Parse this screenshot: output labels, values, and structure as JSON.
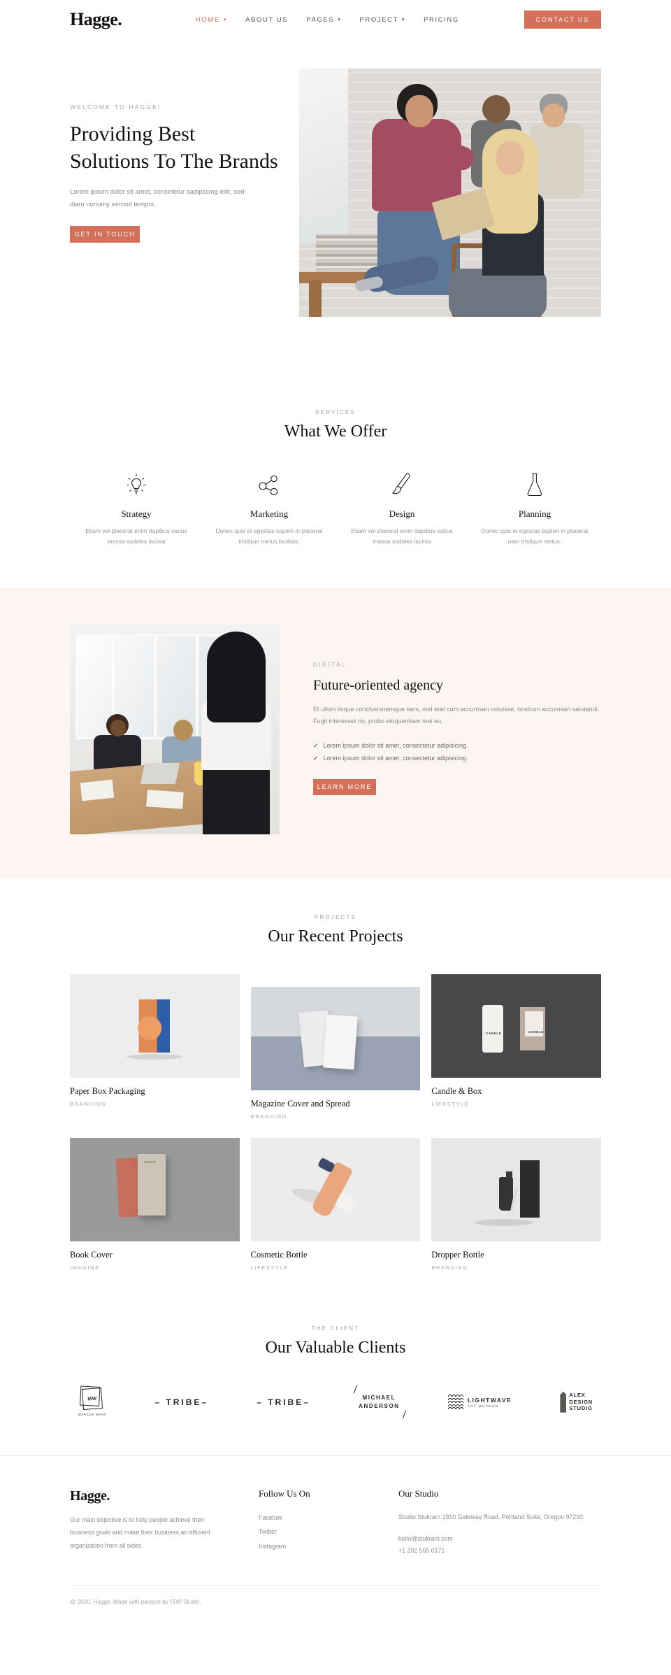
{
  "header": {
    "brand": "Hagge.",
    "nav": [
      {
        "label": "HOME",
        "has_caret": true,
        "active": true
      },
      {
        "label": "ABOUT US",
        "has_caret": false,
        "active": false
      },
      {
        "label": "PAGES",
        "has_caret": true,
        "active": false
      },
      {
        "label": "PROJECT",
        "has_caret": true,
        "active": false
      },
      {
        "label": "PRICING",
        "has_caret": false,
        "active": false
      }
    ],
    "cta_label": "CONTACT US"
  },
  "hero": {
    "eyebrow": "WELCOME TO HAGGE!",
    "title": "Providing Best Solutions To The Brands",
    "text": "Lorem ipsum dolor sit amet, consetetur sadipscing elitr, sed diam nonumy eirmod tempor.",
    "button": "GET IN TOUCH"
  },
  "services": {
    "eyebrow": "SERVICES",
    "title": "What We Offer",
    "items": [
      {
        "icon": "lightbulb-icon",
        "name": "Strategy",
        "desc": "Etiam vel placerat enim dapibus varius massa sodales lacinia"
      },
      {
        "icon": "network-icon",
        "name": "Marketing",
        "desc": "Donec quis et egestas sapien in placerat tristique metus facilisis."
      },
      {
        "icon": "brush-icon",
        "name": "Design",
        "desc": "Etiam vel placerat enim dapibus varius massa sodales lacinia"
      },
      {
        "icon": "flask-icon",
        "name": "Planning",
        "desc": "Donec quis et egestas sapien in placerat nam tristique metus."
      }
    ]
  },
  "about": {
    "eyebrow": "DIGITAL",
    "title": "Future-oriented agency",
    "paragraph": "Et ullum iisque conclusionemque eam, mel erat cum accumsan noluisse, nostrum accumsan salutandi. Fugit interesset no, probo eloquentiam mei eu.",
    "list": [
      "Lorem ipsum dolor sit amet, consectetur adipisicing.",
      "Lorem ipsum dolor sit amet, consectetur adipisicing."
    ],
    "button": "LEARN MORE"
  },
  "projects": {
    "eyebrow": "PROJECTS",
    "title": "Our Recent Projects",
    "items": [
      {
        "name": "Paper Box Packaging",
        "category": "BRANDING"
      },
      {
        "name": "Magazine Cover and Spread",
        "category": "BRANDING"
      },
      {
        "name": "Candle & Box",
        "category": "LIFESTYLE"
      },
      {
        "name": "Book Cover",
        "category": "IMAGINE"
      },
      {
        "name": "Cosmetic Bottle",
        "category": "LIFESTYLE"
      },
      {
        "name": "Dropper Bottle",
        "category": "BRANDING"
      }
    ]
  },
  "clients": {
    "eyebrow": "THE CLIENT",
    "title": "Our Valuable Clients",
    "logos": [
      {
        "type": "marcus-wayn",
        "mark": "MW",
        "sub": "MARCUS WAYN"
      },
      {
        "type": "tribe",
        "text": "– TRIBE–"
      },
      {
        "type": "tribe",
        "text": "– TRIBE–"
      },
      {
        "type": "michael-anderson",
        "line1": "MICHAEL",
        "line2": "ANDERSON"
      },
      {
        "type": "lightwave",
        "line1": "LIGHTWAVE",
        "line2": "ART MUSEUM"
      },
      {
        "type": "alex-design-studio",
        "line1": "ALEX",
        "line2": "DESIGN",
        "line3": "STUDIO"
      }
    ]
  },
  "footer": {
    "brand": "Hagge.",
    "about": "Our main objective is to help people achieve their business goals and make their business an efficient organization from all sides.",
    "follow_heading": "Follow Us On",
    "social": [
      "Facebok",
      "Twitter",
      "Instagram"
    ],
    "studio_heading": "Our Studio",
    "address": "Studio Stukram 1910 Gateway Road, Portland Suite, Oregon 97230",
    "email": "hello@stukram.com",
    "phone": "+1 202 555 0171",
    "copyright": "@ 2020, Hagge. Made with passion by FDR Studio."
  },
  "theme": {
    "accent": "#d4705a",
    "ink": "#14100f",
    "muted": "#908b88",
    "pink_bg": "#fdf5f2"
  }
}
